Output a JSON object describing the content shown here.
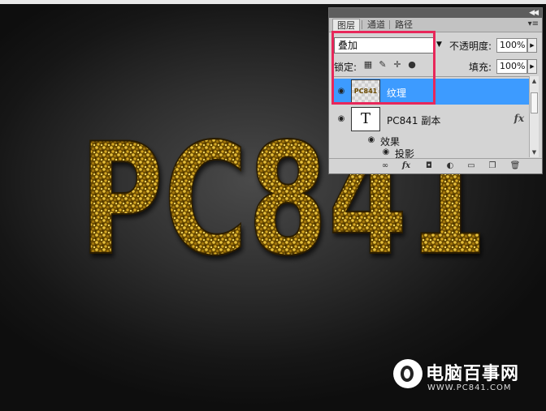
{
  "canvas": {
    "artwork_text": "PC841"
  },
  "layers_panel": {
    "tabs": [
      "图层",
      "通道",
      "路径"
    ],
    "blend_mode": "叠加",
    "opacity_label": "不透明度:",
    "opacity_value": "100%",
    "lock_label": "锁定:",
    "fill_label": "填充:",
    "fill_value": "100%",
    "layers": [
      {
        "name": "纹理",
        "thumb_text": "PC841",
        "selected": true
      },
      {
        "name": "PC841 副本",
        "thumb_text": "T",
        "fx": "fx"
      }
    ],
    "effects_label": "效果",
    "effect_item": "投影",
    "bottom_icons": [
      "link-icon",
      "fx-icon",
      "mask-icon",
      "adjustment-icon",
      "folder-icon",
      "new-layer-icon",
      "trash-icon"
    ]
  },
  "watermark": {
    "name": "电脑百事网",
    "url": "WWW.PC841.COM"
  },
  "colors": {
    "selection": "#3d9bff",
    "highlight": "#e8275a",
    "gold": "#c79a12"
  }
}
